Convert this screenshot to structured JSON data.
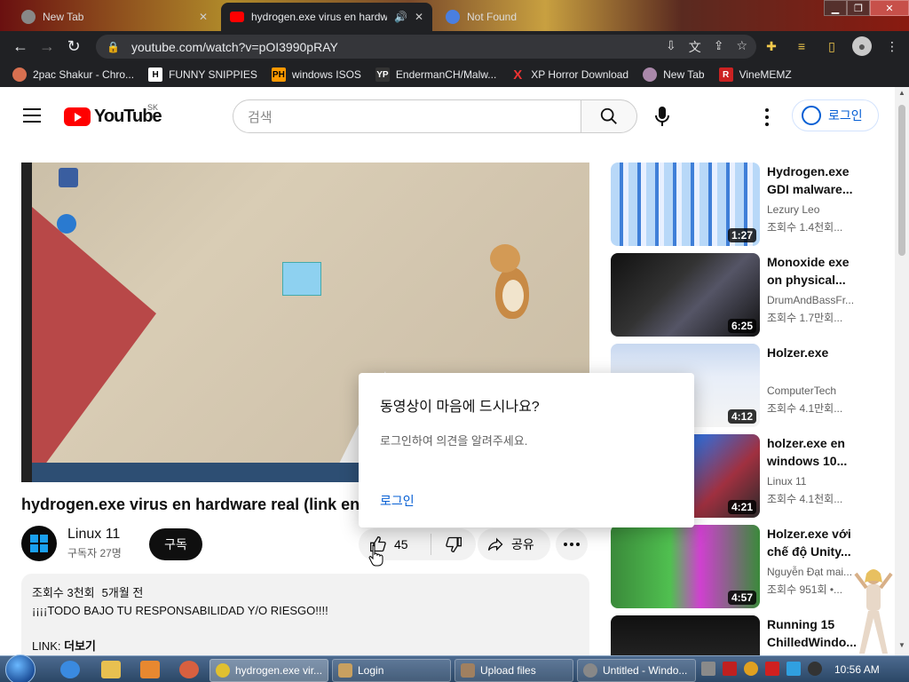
{
  "browser": {
    "tabs": [
      {
        "title": "New Tab",
        "active": false
      },
      {
        "title": "hydrogen.exe virus en hardw",
        "active": true
      },
      {
        "title": "Not Found",
        "active": false
      }
    ],
    "url": "youtube.com/watch?v=pOI3990pRAY",
    "bookmarks": [
      {
        "label": "2pac Shakur - Chro...",
        "icon": "music-icon"
      },
      {
        "label": "FUNNY SNIPPIES",
        "icon": "H"
      },
      {
        "label": "windows ISOS",
        "icon": "PH"
      },
      {
        "label": "EndermanCH/Malw...",
        "icon": "YP"
      },
      {
        "label": "XP Horror Download",
        "icon": "X"
      },
      {
        "label": "New Tab",
        "icon": "globe-icon"
      },
      {
        "label": "VineMEMZ",
        "icon": "R"
      }
    ]
  },
  "youtube": {
    "logo_text": "YouTube",
    "country_code": "SK",
    "search_placeholder": "검색",
    "login_label": "로그인",
    "video": {
      "title": "hydrogen.exe virus en hardware real (link en",
      "channel": "Linux 11",
      "subscribers": "구독자 27명",
      "subscribe_label": "구독",
      "likes": "45",
      "share_label": "공유",
      "views": "조회수 3천회",
      "age": "5개월 전",
      "description": "¡¡¡¡TODO BAJO TU RESPONSABILIDAD Y/O RIESGO!!!!",
      "link_label": "LINK:",
      "more_label": "더보기"
    },
    "popup": {
      "heading": "동영상이 마음에 드시나요?",
      "text": "로그인하여 의견을 알려주세요.",
      "link": "로그인"
    },
    "recommendations": [
      {
        "title": "Hydrogen.exe GDI malware...",
        "channel": "Lezury Leo",
        "views": "조회수 1.4천회...",
        "duration": "1:27"
      },
      {
        "title": "Monoxide exe on physical...",
        "channel": "DrumAndBassFr...",
        "views": "조회수 1.7만회...",
        "duration": "6:25"
      },
      {
        "title": "Holzer.exe",
        "channel": "ComputerTech",
        "views": "조회수 4.1만회...",
        "duration": "4:12"
      },
      {
        "title": "holzer.exe en windows 10...",
        "channel": "Linux 11",
        "views": "조회수 4.1천회...",
        "duration": "4:21"
      },
      {
        "title": "Holzer.exe với chế độ Unity...",
        "channel": "Nguyễn Đạt mai...",
        "views": "조회수 951회 •...",
        "duration": "4:57"
      },
      {
        "title": "Running 15 ChilledWindo...",
        "channel": "",
        "views": "",
        "duration": ""
      }
    ]
  },
  "taskbar": {
    "buttons": [
      {
        "label": "hydrogen.exe vir...",
        "active": true
      },
      {
        "label": "Login",
        "active": false
      },
      {
        "label": "Upload files",
        "active": false
      },
      {
        "label": "Untitled - Windo...",
        "active": false
      }
    ],
    "clock": "10:56 AM"
  }
}
